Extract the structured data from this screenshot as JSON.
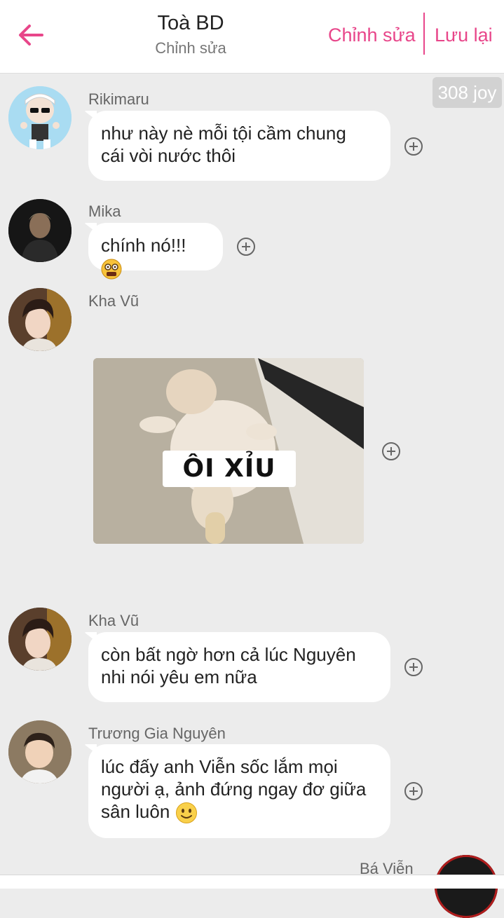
{
  "header": {
    "title": "Toà BD",
    "subtitle": "Chỉnh sửa",
    "edit_label": "Chỉnh sửa",
    "save_label": "Lưu lại",
    "accent_color": "#e8468a"
  },
  "joy_badge": "308 joy",
  "messages": [
    {
      "sender": "Rikimaru",
      "text_lines": [
        "như này nè mỗi tội cầm chung",
        "cái vòi nước thôi"
      ]
    },
    {
      "sender": "Mika",
      "text": "chính nó!!!",
      "emoji": "dizzy-face-emoji"
    },
    {
      "sender": "Kha Vũ",
      "sticker_caption": "ÔI XỈU"
    },
    {
      "sender": "Kha Vũ",
      "text_lines": [
        "còn bất ngờ hơn cả lúc Nguyên",
        "nhi nói yêu em nữa"
      ]
    },
    {
      "sender": "Trương Gia Nguyên",
      "text_lines": [
        "lúc đấy anh Viễn sốc lắm mọi",
        "người ạ, ảnh đứng ngay đơ giữa",
        "sân luôn"
      ],
      "emoji": "slightly-smiling-emoji"
    },
    {
      "sender": "Bá Viễn"
    }
  ]
}
